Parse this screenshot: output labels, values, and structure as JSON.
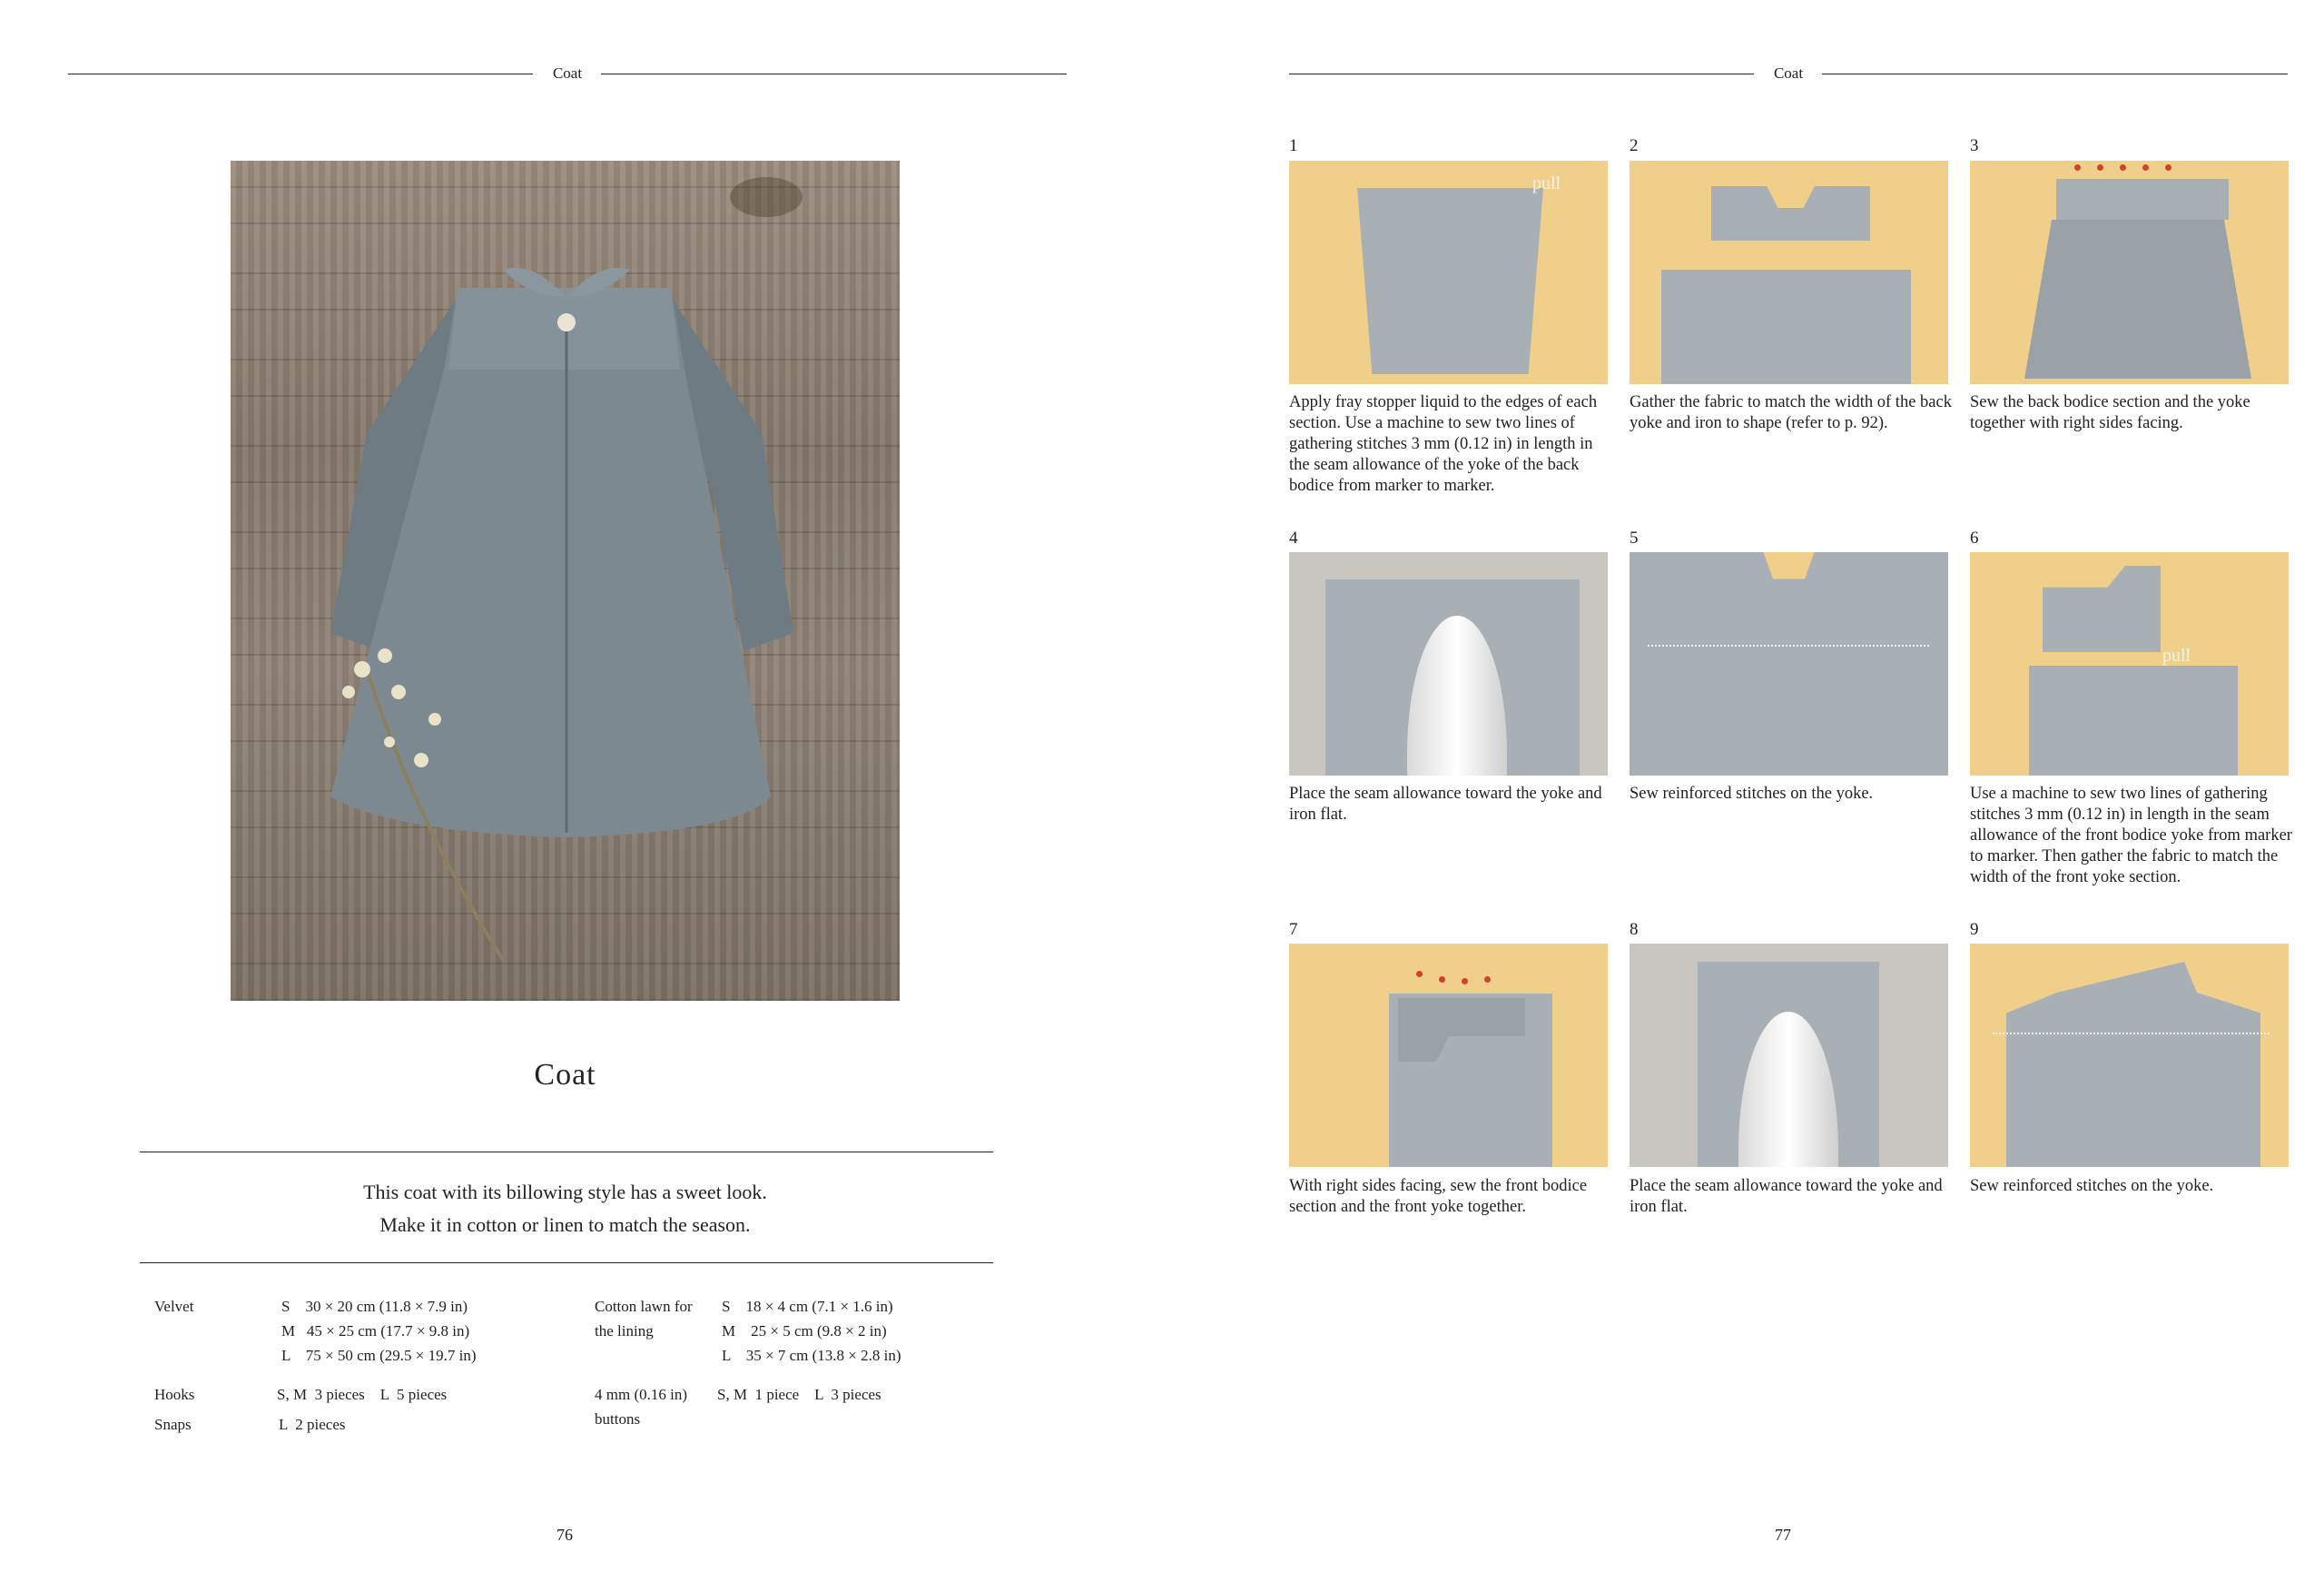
{
  "left_page": {
    "running_head": "Coat",
    "title": "Coat",
    "intro": [
      "This coat with its billowing style has a sweet look.",
      "Make it in cotton or linen to match the season."
    ],
    "materials_col1": [
      {
        "name": "Velvet",
        "sizes": [
          "S    30 × 20 cm (11.8 × 7.9 in)",
          "M   45 × 25 cm (17.7 × 9.8 in)",
          "L    75 × 50 cm (29.5 × 19.7 in)"
        ]
      },
      {
        "name": "Hooks",
        "sizes": [
          "S, M  3 pieces    L  5 pieces"
        ]
      },
      {
        "name": "Snaps",
        "sizes": [
          "L  2 pieces"
        ]
      }
    ],
    "materials_col2": [
      {
        "name": [
          "Cotton lawn for",
          "the lining"
        ],
        "sizes": [
          "S    18 × 4 cm (7.1 × 1.6 in)",
          "M    25 × 5 cm (9.8 × 2 in)",
          "L    35 × 7 cm (13.8 × 2.8 in)"
        ]
      },
      {
        "name": [
          "4 mm (0.16 in)",
          "buttons"
        ],
        "sizes": [
          "S, M  1 piece    L  3 pieces"
        ]
      }
    ],
    "folio": "76"
  },
  "right_page": {
    "running_head": "Coat",
    "folio": "77",
    "steps": [
      {
        "num": "1",
        "text": "Apply fray stopper liquid to the edges of each section. Use a machine to sew two lines of gathering stitches 3 mm (0.12 in) in length in the seam allowance of the yoke of the back bodice from marker to marker.",
        "photo_label": "pull"
      },
      {
        "num": "2",
        "text": "Gather the fabric to match the width of the back yoke and iron to shape (refer to p. 92)."
      },
      {
        "num": "3",
        "text": "Sew the back bodice section and the yoke together with right sides facing."
      },
      {
        "num": "4",
        "text": "Place the seam allowance toward the yoke and iron flat."
      },
      {
        "num": "5",
        "text": "Sew reinforced stitches on the yoke."
      },
      {
        "num": "6",
        "text": "Use a machine to sew two lines of gathering stitches 3 mm (0.12 in) in length in the seam allowance of the front bodice yoke from marker to marker. Then gather the fabric to match the width of the front yoke section.",
        "photo_label": "pull"
      },
      {
        "num": "7",
        "text": "With right sides facing, sew the front bodice section and the front yoke together."
      },
      {
        "num": "8",
        "text": "Place the seam allowance toward the yoke and iron flat."
      },
      {
        "num": "9",
        "text": "Sew reinforced stitches on the yoke."
      }
    ]
  }
}
